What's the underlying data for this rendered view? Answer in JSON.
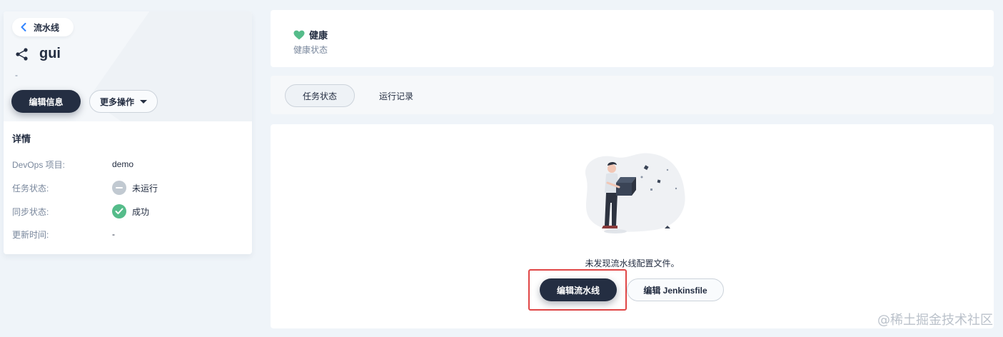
{
  "sidebar": {
    "back_label": "流水线",
    "pipeline_name": "gui",
    "description": "-",
    "edit_info_label": "编辑信息",
    "more_actions_label": "更多操作",
    "details_title": "详情",
    "details": [
      {
        "key": "DevOps 项目:",
        "value": "demo"
      },
      {
        "key": "任务状态:",
        "value": "未运行"
      },
      {
        "key": "同步状态:",
        "value": "成功"
      },
      {
        "key": "更新时间:",
        "value": "-"
      }
    ]
  },
  "health": {
    "title": "健康",
    "subtitle": "健康状态",
    "icon": "heart-icon",
    "color": "#55bc8a"
  },
  "tabs": [
    {
      "label": "任务状态",
      "active": true
    },
    {
      "label": "运行记录",
      "active": false
    }
  ],
  "main": {
    "empty_message": "未发现流水线配置文件。",
    "edit_pipeline_label": "编辑流水线",
    "edit_jenkinsfile_label": "编辑 Jenkinsfile"
  },
  "watermark": "@稀土掘金技术社区",
  "colors": {
    "primary_dark": "#242e42",
    "success": "#55bc8a",
    "muted": "#79879c",
    "highlight": "#e04646"
  }
}
